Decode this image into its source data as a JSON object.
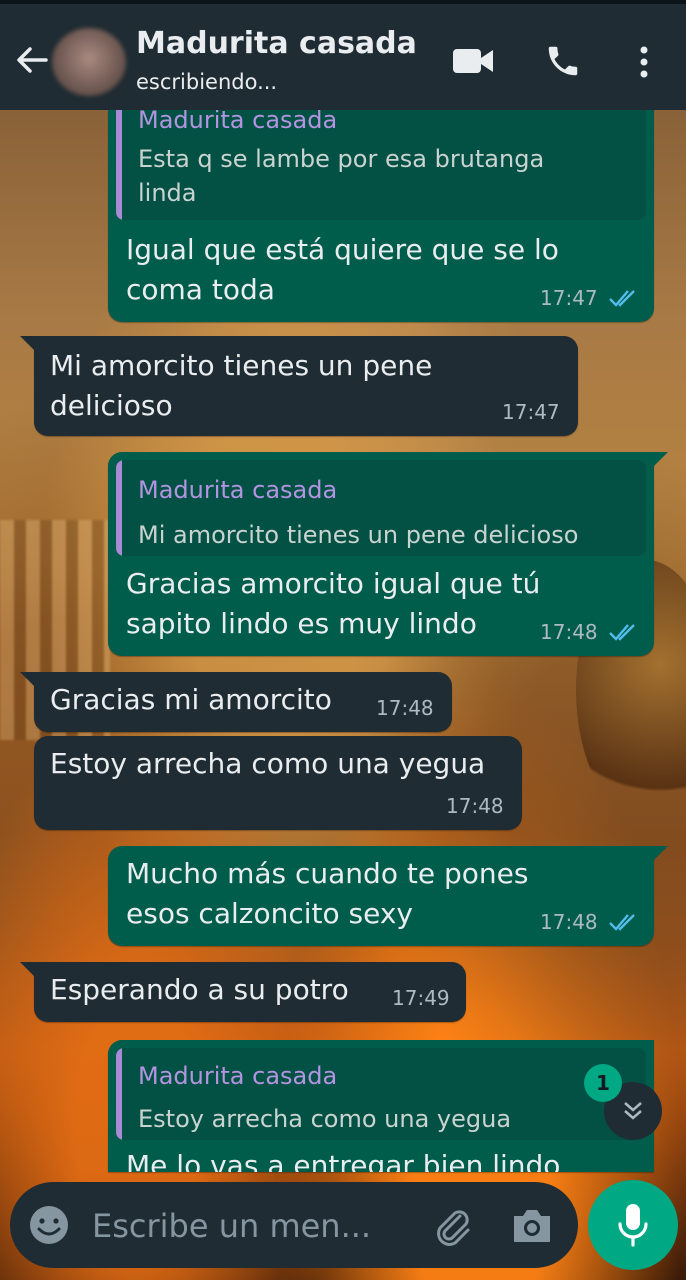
{
  "header": {
    "contact_name": "Madurita casada",
    "status": "escribiendo..."
  },
  "messages": [
    {
      "direction": "out",
      "quote_name": "Madurita casada",
      "quote_lines": [
        "Esta q se lambe por esa brutanga",
        "linda"
      ],
      "lines": [
        "Igual que está quiere que se lo",
        "coma toda"
      ],
      "time": "17:47",
      "read": true
    },
    {
      "direction": "in",
      "lines": [
        "Mi amorcito tienes un pene",
        "delicioso"
      ],
      "time": "17:47"
    },
    {
      "direction": "out",
      "quote_name": "Madurita casada",
      "quote_lines": [
        "Mi amorcito tienes un pene delicioso"
      ],
      "lines": [
        "Gracias amorcito igual que tú",
        "sapito lindo es muy lindo"
      ],
      "time": "17:48",
      "read": true
    },
    {
      "direction": "in",
      "lines": [
        "Gracias mi amorcito"
      ],
      "time": "17:48"
    },
    {
      "direction": "in",
      "lines": [
        "Estoy arrecha como una yegua"
      ],
      "time": "17:48"
    },
    {
      "direction": "out",
      "lines": [
        "Mucho más cuando te pones",
        "esos calzoncito sexy"
      ],
      "time": "17:48",
      "read": true
    },
    {
      "direction": "in",
      "lines": [
        "Esperando a su potro"
      ],
      "time": "17:49"
    },
    {
      "direction": "out",
      "quote_name": "Madurita casada",
      "quote_lines": [
        "Estoy arrecha como una yegua"
      ],
      "lines": [
        "Me lo vas a entregar bien lindo"
      ],
      "time": "",
      "read": false
    }
  ],
  "scroll_down": {
    "unread_count": "1"
  },
  "composer": {
    "placeholder": "Escribe un men..."
  },
  "colors": {
    "header": "#1f2c33",
    "outgoing_bubble": "#005c4b",
    "incoming_bubble": "#1f2c33",
    "quote_name": "#b394e0",
    "read_ticks": "#53bdeb",
    "accent": "#00a884"
  },
  "icons": [
    "back-arrow-icon",
    "video-call-icon",
    "phone-icon",
    "more-vert-icon",
    "emoji-icon",
    "attach-icon",
    "camera-icon",
    "mic-icon",
    "double-chevron-down-icon"
  ]
}
